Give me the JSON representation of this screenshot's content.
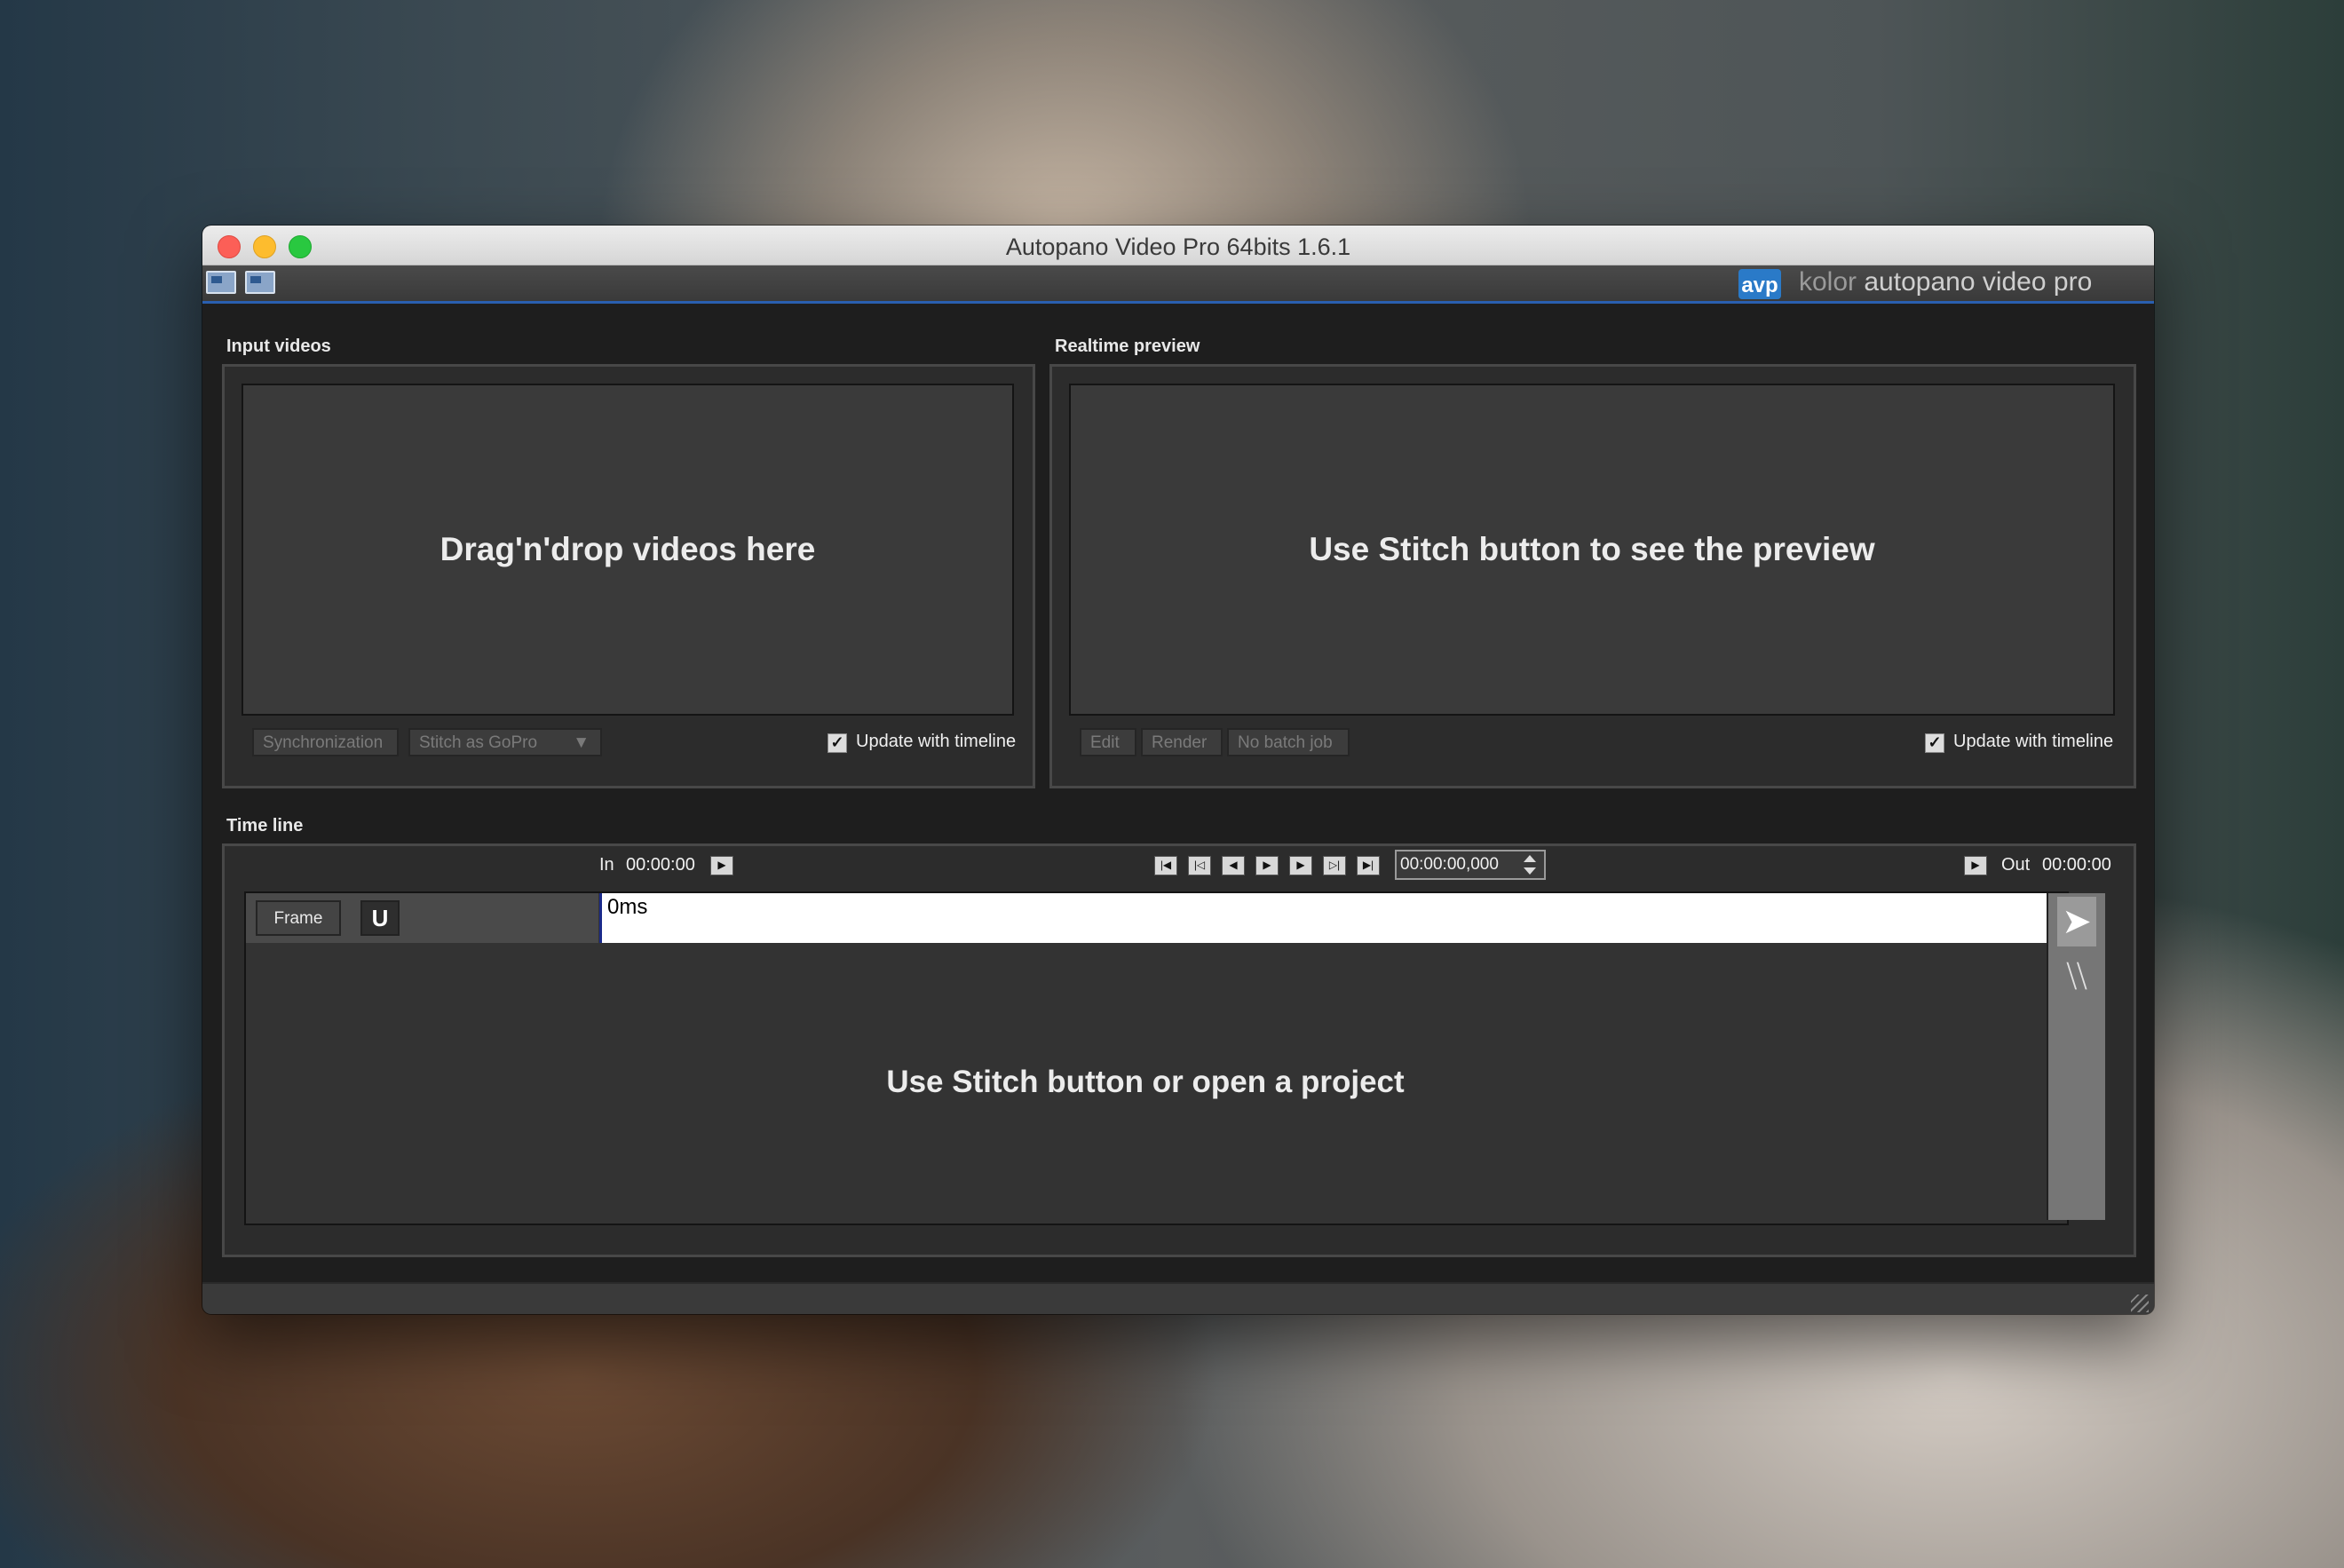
{
  "window": {
    "title": "Autopano Video Pro 64bits 1.6.1"
  },
  "brand": {
    "logo": "avp",
    "prefix": "kolor",
    "name": "autopano video pro"
  },
  "toolbar": {
    "icons": [
      "open-video-icon",
      "import-video-icon"
    ]
  },
  "input_videos": {
    "label": "Input videos",
    "placeholder": "Drag'n'drop videos here",
    "sync_button": "Synchronization",
    "stitch_select": "Stitch  as GoPro",
    "update_label": "Update with timeline",
    "update_checked": true
  },
  "realtime_preview": {
    "label": "Realtime preview",
    "placeholder": "Use Stitch button to see the preview",
    "edit_button": "Edit",
    "render_button": "Render",
    "batch_button": "No batch job",
    "update_label": "Update with timeline",
    "update_checked": true
  },
  "timeline": {
    "label": "Time line",
    "in_label": "In",
    "in_time": "00:00:00",
    "out_label": "Out",
    "out_time": "00:00:00",
    "current_time": "00:00:00,000",
    "frame_button": "Frame",
    "ruler_text": "0ms",
    "placeholder": "Use Stitch button or open a project",
    "transport": [
      "go-start-icon",
      "prev-key-icon",
      "step-back-icon",
      "play-icon",
      "step-forward-icon",
      "next-key-icon",
      "go-end-icon"
    ]
  },
  "colors": {
    "accent": "#2a5fb0",
    "panel": "#2c2c2c",
    "dropzone": "#3a3a3a"
  }
}
